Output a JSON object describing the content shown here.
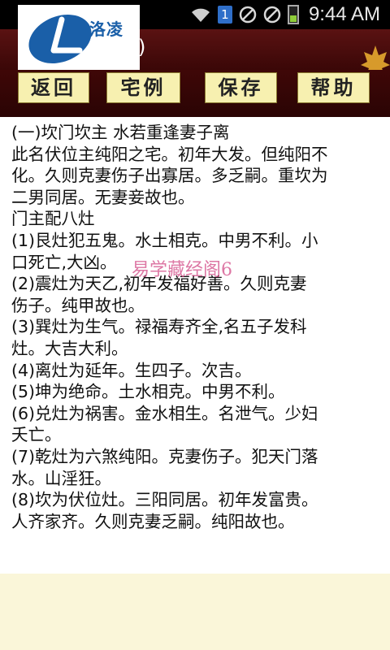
{
  "status_bar": {
    "sim_label": "1",
    "time": "9:44 AM",
    "icons": [
      "wifi-icon",
      "sim-icon",
      "no-sign-icon",
      "no-sign-icon",
      "battery-icon"
    ]
  },
  "logo": {
    "text": "洛凌"
  },
  "title_bar": {
    "partial_text": ")"
  },
  "toolbar": {
    "buttons": [
      {
        "label": "返回"
      },
      {
        "label": "宅例"
      },
      {
        "label": "保存"
      },
      {
        "label": "帮助"
      }
    ]
  },
  "content": {
    "lines": [
      "(一)坎门坎主 水若重逢妻子离",
      "此名伏位主纯阳之宅。初年大发。但纯阳不",
      "化。久则克妻伤子出寡居。多乏嗣。重坎为",
      "二男同居。无妻妾故也。",
      "门主配八灶",
      "(1)艮灶犯五鬼。水土相克。中男不利。小",
      "口死亡,大凶。",
      "(2)震灶为天乙,初年发福好善。久则克妻",
      "伤子。纯甲故也。",
      "(3)巽灶为生气。禄福寿齐全,名五子发科",
      "灶。大吉大利。",
      "(4)离灶为延年。生四子。次吉。",
      "(5)坤为绝命。土水相克。中男不利。",
      "(6)兑灶为祸害。金水相生。名泄气。少妇",
      "夭亡。",
      "(7)乾灶为六煞纯阳。克妻伤子。犯天门落",
      "水。山淫狂。",
      "(8)坎为伏位灶。三阳同居。初年发富贵。",
      "人齐家齐。久则克妻乏嗣。纯阳故也。"
    ]
  },
  "watermark": {
    "text": "易学藏经阁6"
  },
  "colors": {
    "title_bg": "#4a0c0c",
    "button_bg": "#f7f0b0",
    "footer_bg": "#faf6d9",
    "logo_blue": "#1a5fa8",
    "watermark": "#d24a86"
  }
}
